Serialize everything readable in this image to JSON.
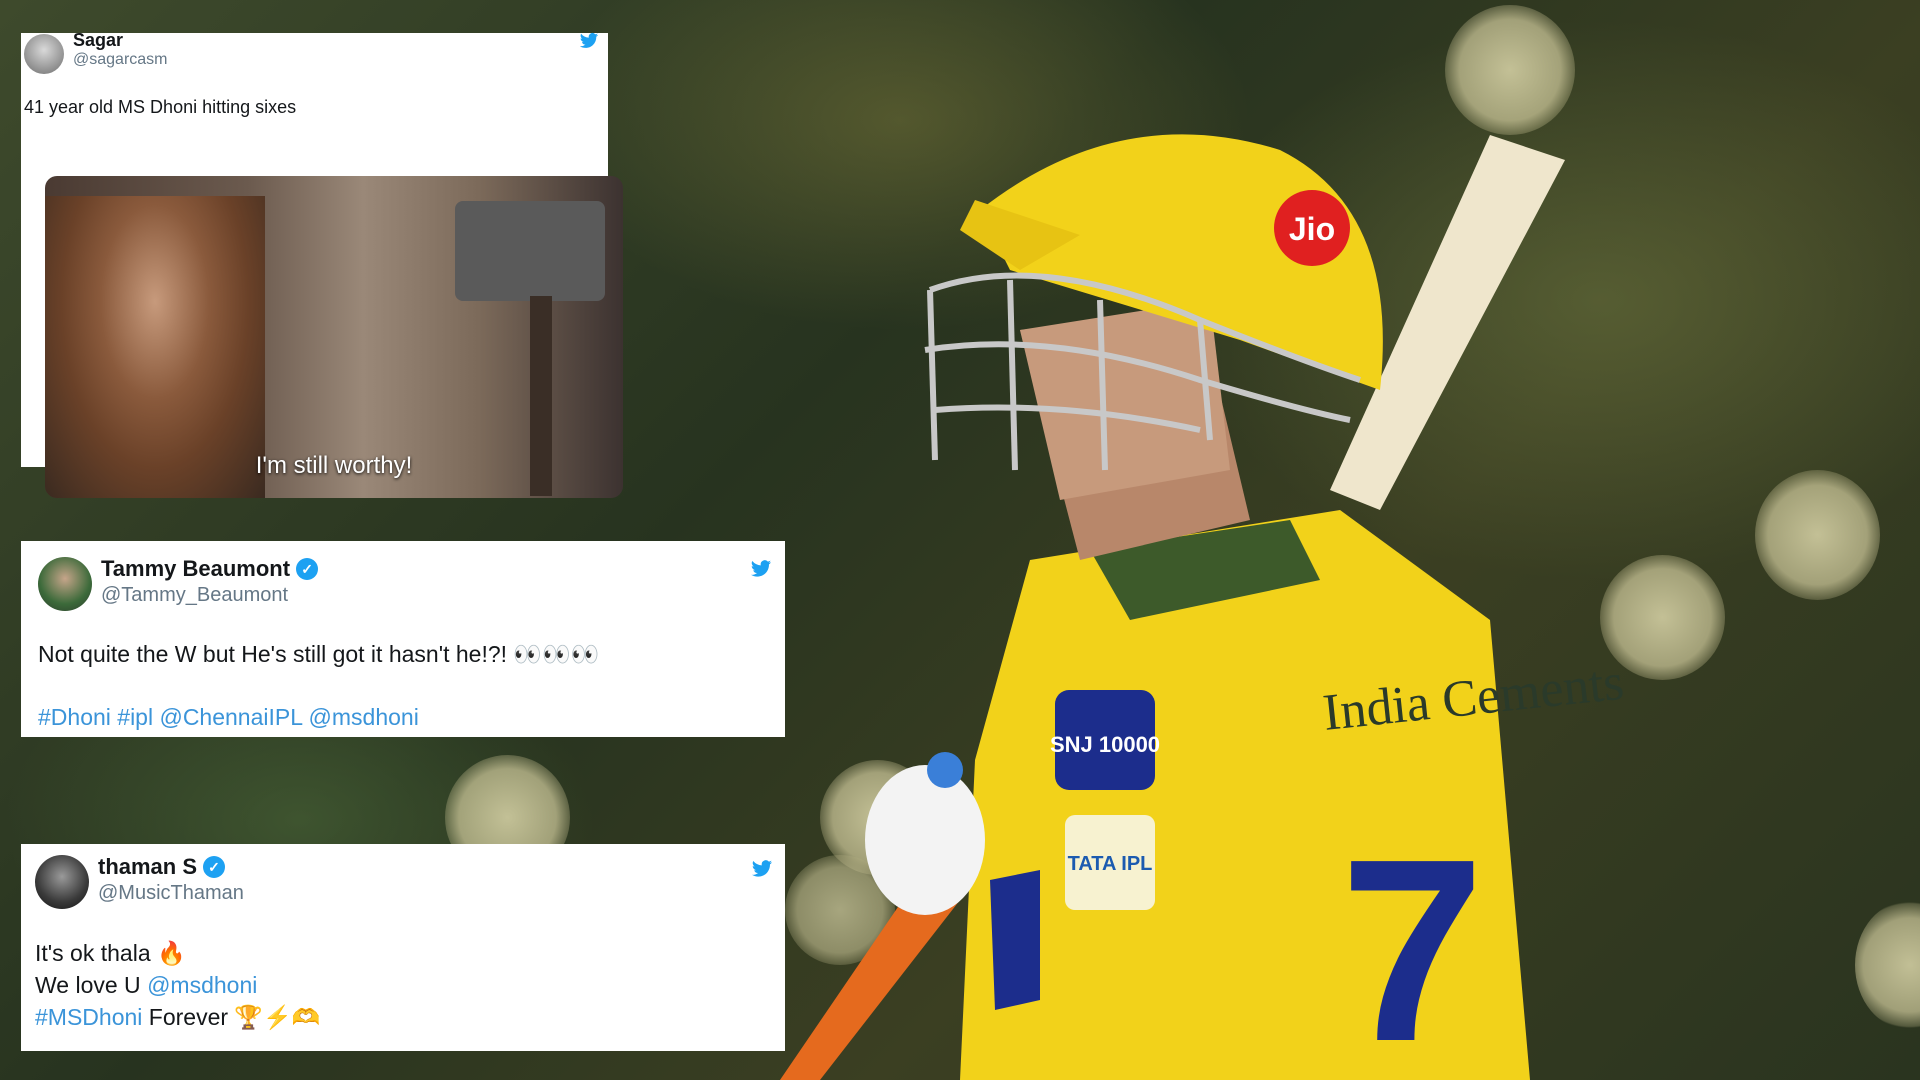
{
  "tweets": [
    {
      "name": "Sagar",
      "handle": "@sagarcasm",
      "text": "41 year old MS Dhoni hitting sixes",
      "image_caption": "I'm still worthy!"
    },
    {
      "name": "Tammy Beaumont",
      "handle": "@Tammy_Beaumont",
      "text": "Not quite the W but He's still got it hasn't he!?! 👀👀👀",
      "tags": "#Dhoni #ipl @ChennaiIPL @msdhoni"
    },
    {
      "name": "thaman S",
      "handle": "@MusicThaman",
      "line1": "It's ok thala 🔥",
      "line2_prefix": "We love U ",
      "line2_link": "@msdhoni",
      "line3_link": "#MSDhoni",
      "line3_rest": " Forever 🏆⚡🫶"
    }
  ],
  "jersey": {
    "helmet_logo": "Jio",
    "sponsor": "SNJ 10000",
    "brand": "India Cements",
    "number": "7",
    "badge": "TATA IPL"
  },
  "colors": {
    "twitter_blue": "#1da1f2",
    "jersey_yellow": "#f2d21a",
    "link": "#3b94d9"
  },
  "icons": [
    "twitter-bird-icon",
    "verified-badge-icon"
  ]
}
